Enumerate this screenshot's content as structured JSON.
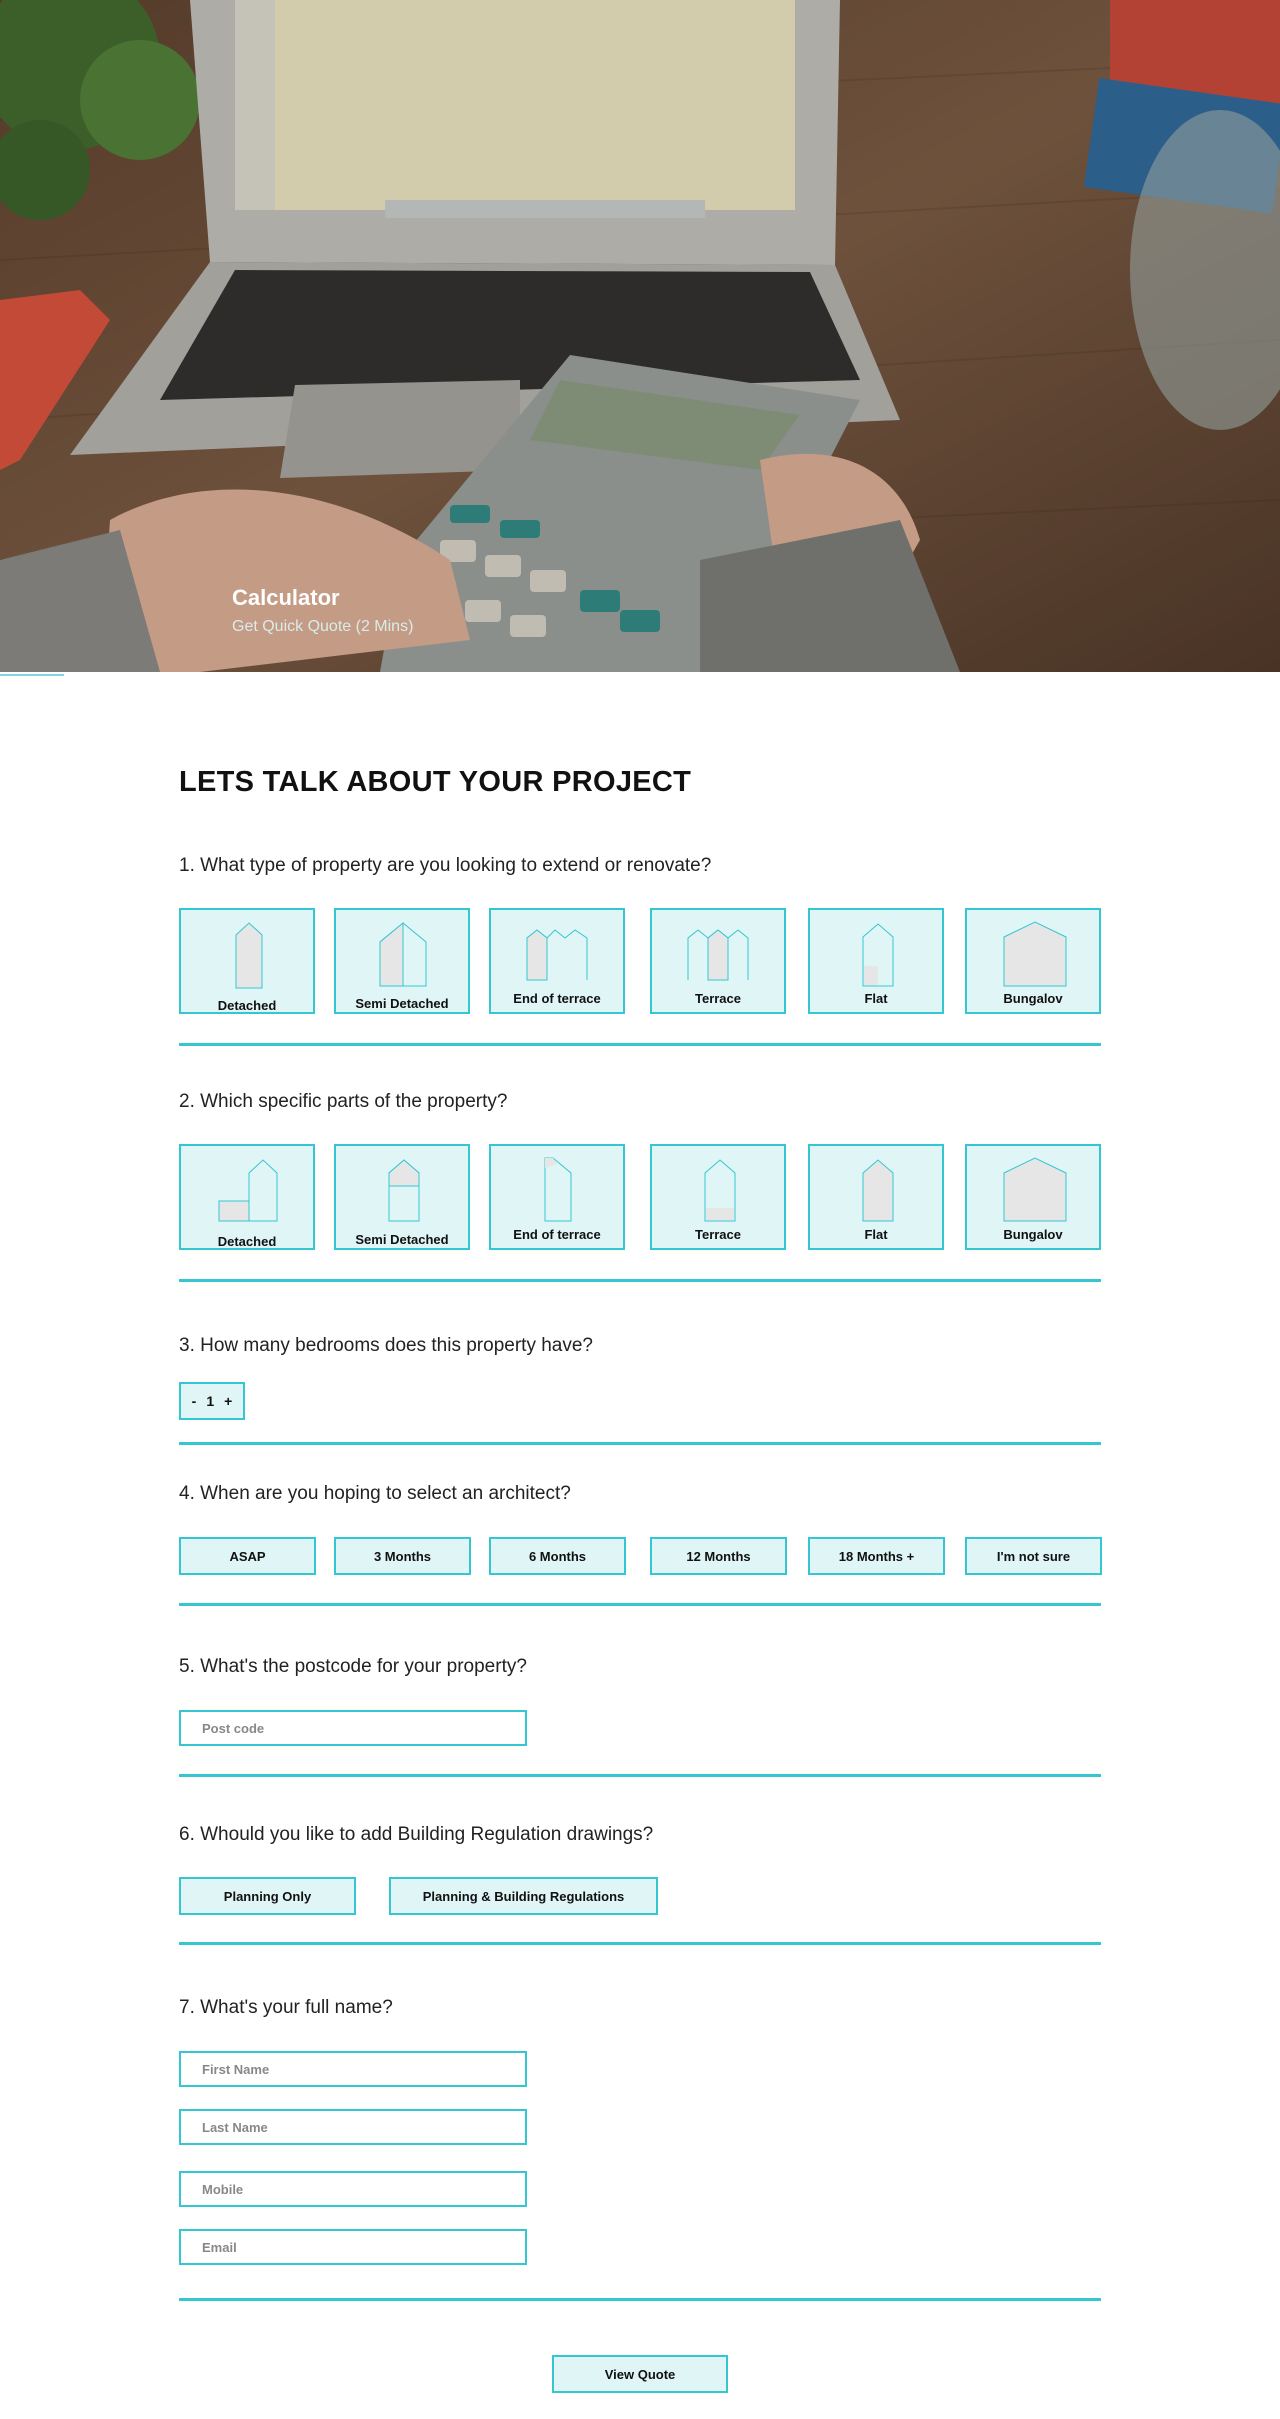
{
  "hero": {
    "title": "Calculator",
    "subtitle": "Get Quick Quote (2 Mins)"
  },
  "form": {
    "heading": "LETS TALK ABOUT YOUR PROJECT",
    "q1": {
      "question": "1. What type of property are you looking to extend or renovate?",
      "options": [
        "Detached",
        "Semi Detached",
        "End of terrace",
        "Terrace",
        "Flat",
        "Bungalov"
      ]
    },
    "q2": {
      "question": "2. Which specific parts of the property?",
      "options": [
        "Detached",
        "Semi Detached",
        "End of terrace",
        "Terrace",
        "Flat",
        "Bungalov"
      ]
    },
    "q3": {
      "question": "3. How many bedrooms does this property have?",
      "minus": "-",
      "value": "1",
      "plus": "+"
    },
    "q4": {
      "question": "4. When are you hoping to select an architect?",
      "options": [
        "ASAP",
        "3 Months",
        "6 Months",
        "12 Months",
        "18 Months +",
        "I'm not sure"
      ]
    },
    "q5": {
      "question": "5. What's the postcode for your property?",
      "placeholder": "Post code"
    },
    "q6": {
      "question": "6. Whould you like to add Building Regulation drawings?",
      "options": [
        "Planning Only",
        "Planning & Building Regulations"
      ]
    },
    "q7": {
      "question": "7. What's your full name?",
      "first": "First Name",
      "last": "Last Name",
      "mobile": "Mobile",
      "email": "Email"
    },
    "submit": "View Quote"
  },
  "colors": {
    "accent": "#34c6d1",
    "card_bg": "#dff5f6"
  }
}
